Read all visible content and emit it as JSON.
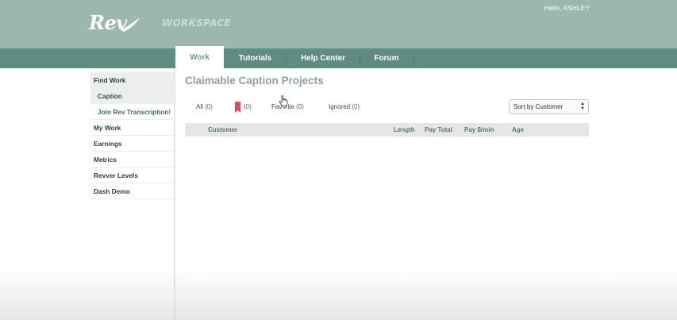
{
  "header": {
    "logo_text": "Rev",
    "section_label": "WORKSPACE",
    "greeting": "Hello, ASHLEY"
  },
  "nav": {
    "tabs": [
      {
        "label": "Work",
        "active": true
      },
      {
        "label": "Tutorials",
        "active": false
      },
      {
        "label": "Help Center",
        "active": false
      },
      {
        "label": "Forum",
        "active": false
      }
    ]
  },
  "sidebar": {
    "items": [
      {
        "label": "Find Work",
        "type": "header"
      },
      {
        "label": "Caption",
        "type": "sub-selected"
      },
      {
        "label": "Join Rev Transcription!",
        "type": "sub"
      },
      {
        "label": "My Work",
        "type": "item"
      },
      {
        "label": "Earnings",
        "type": "item"
      },
      {
        "label": "Metrics",
        "type": "item"
      },
      {
        "label": "Revver Levels",
        "type": "item"
      },
      {
        "label": "Dash Demo",
        "type": "item"
      }
    ]
  },
  "main": {
    "title": "Claimable Caption Projects",
    "filters": [
      {
        "label": "All",
        "count": "(0)"
      },
      {
        "label": "",
        "count": "(0)",
        "icon": "bookmark-icon"
      },
      {
        "label": "Favorite",
        "count": "(0)"
      },
      {
        "label": "Ignored",
        "count": "(0)"
      }
    ],
    "sort": {
      "selected": "Sort by Customer"
    },
    "table": {
      "columns": [
        "Customer",
        "Length",
        "Pay Total",
        "Pay $/min",
        "Age"
      ],
      "rows": []
    }
  },
  "colors": {
    "header_bg": "#9bb8ae",
    "nav_bg": "#5e8c80",
    "title_color": "#8da39d",
    "bookmark_color": "#d9505e"
  }
}
